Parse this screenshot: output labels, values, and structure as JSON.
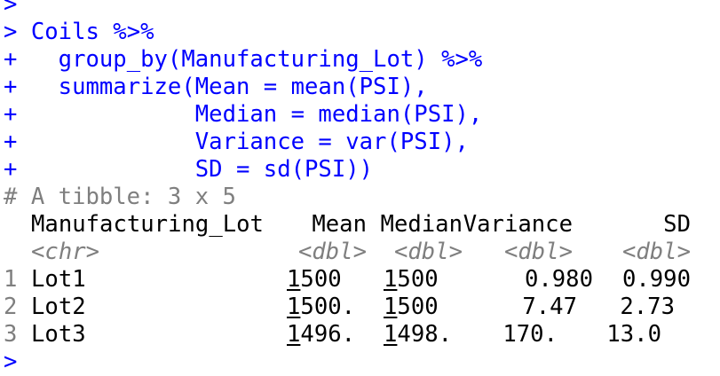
{
  "console": {
    "prompt_symbol": ">",
    "continuation_symbol": "+",
    "command_lines": [
      "Coils %>%",
      "  group_by(Manufacturing_Lot) %>%",
      "  summarize(Mean = mean(PSI),",
      "            Median = median(PSI),",
      "            Variance = var(PSI),",
      "            SD = sd(PSI))"
    ]
  },
  "tibble": {
    "header_comment": "# A tibble: 3 x 5",
    "columns": [
      "Manufacturing_Lot",
      "Mean",
      "Median",
      "Variance",
      "SD"
    ],
    "types": [
      "<chr>",
      "<dbl>",
      "<dbl>",
      "<dbl>",
      "<dbl>"
    ],
    "rows": [
      {
        "index": "1",
        "lot": "Lot1",
        "mean_lead": "1",
        "mean_rest": "500",
        "median_lead": "1",
        "median_rest": "500",
        "variance": "0.980",
        "sd": "0.990"
      },
      {
        "index": "2",
        "lot": "Lot2",
        "mean_lead": "1",
        "mean_rest": "500.",
        "median_lead": "1",
        "median_rest": "500",
        "variance": "7.47",
        "sd": "2.73"
      },
      {
        "index": "3",
        "lot": "Lot3",
        "mean_lead": "1",
        "mean_rest": "496.",
        "median_lead": "1",
        "median_rest": "498.",
        "variance": "170.",
        "sd": "13.0"
      }
    ]
  },
  "colors": {
    "code": "#0000ff",
    "muted": "#7f7f7f",
    "text": "#000000",
    "background": "#ffffff"
  }
}
